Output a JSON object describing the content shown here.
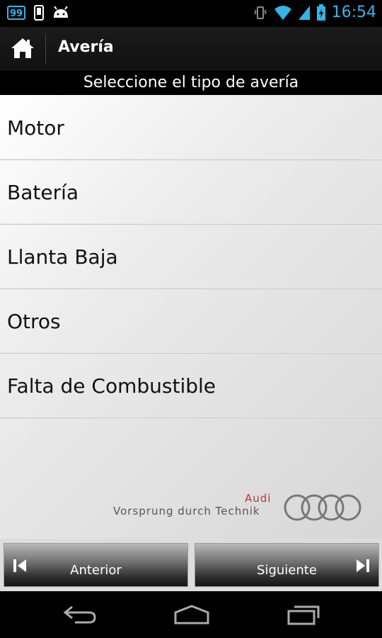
{
  "status_bar": {
    "badge": "99",
    "time": "16:54",
    "icons": [
      "notification-99-icon",
      "phone-icon",
      "android-icon",
      "vibrate-icon",
      "wifi-icon",
      "signal-icon",
      "battery-icon"
    ],
    "accent_color": "#33b5e5"
  },
  "action_bar": {
    "title": "Avería",
    "home_icon": "home-icon"
  },
  "header": {
    "text": "Seleccione el tipo de avería"
  },
  "list": {
    "items": [
      "Motor",
      "Batería",
      "Llanta Baja",
      "Otros",
      "Falta de Combustible"
    ]
  },
  "brand": {
    "name": "Audi",
    "slogan": "Vorsprung durch Technik",
    "logo_icon": "audi-rings-icon",
    "color": "#c03040"
  },
  "buttons": {
    "previous": "Anterior",
    "next": "Siguiente"
  },
  "nav_bar": {
    "icons": [
      "back-icon",
      "home-nav-icon",
      "recent-apps-icon"
    ]
  }
}
